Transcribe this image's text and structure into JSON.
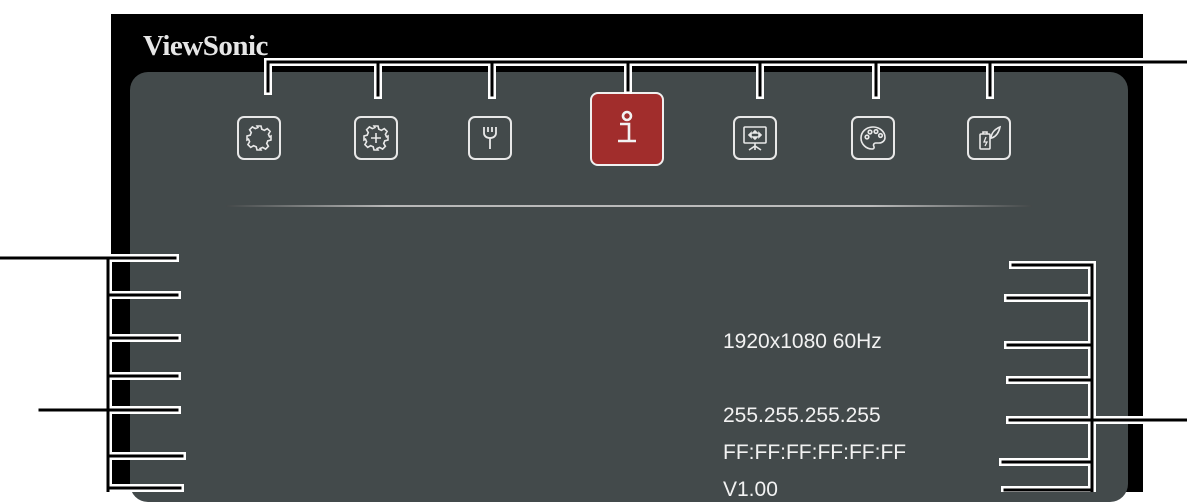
{
  "brand": {
    "logo_text": "ViewSonic"
  },
  "menu": {
    "tabs": [
      {
        "name": "image-settings-icon",
        "active": false
      },
      {
        "name": "advanced-image-settings-icon",
        "active": false
      },
      {
        "name": "settings-wrench-icon",
        "active": false
      },
      {
        "name": "information-icon",
        "active": true
      },
      {
        "name": "display-screen-icon",
        "active": false
      },
      {
        "name": "color-palette-icon",
        "active": false
      },
      {
        "name": "power-management-icon",
        "active": false
      }
    ]
  },
  "info": {
    "resolution": "1920x1080  60Hz",
    "ip_address": "255.255.255.255",
    "mac_address": "FF:FF:FF:FF:FF:FF",
    "firmware_version": "V1.00"
  },
  "colors": {
    "panel_bg": "#434a4b",
    "active_tab": "#a12d2c",
    "callout": "#000000"
  }
}
